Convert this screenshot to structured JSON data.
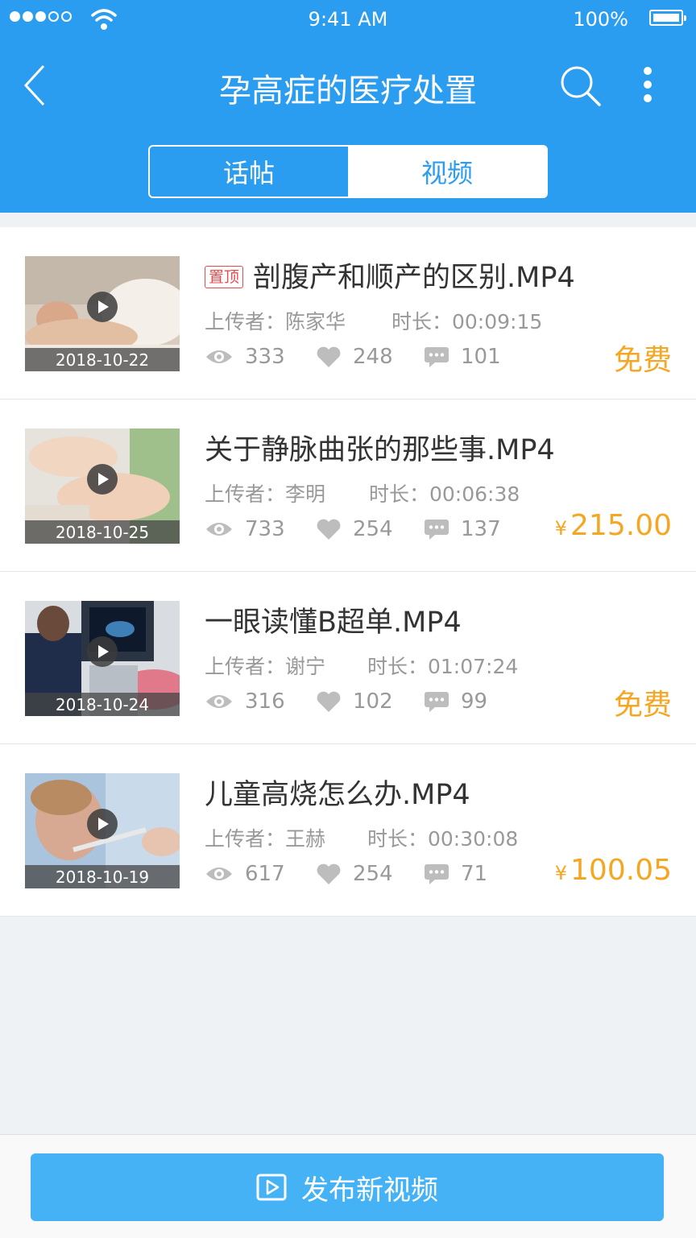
{
  "status_bar": {
    "time": "9:41 AM",
    "battery": "100%"
  },
  "nav": {
    "title": "孕高症的医疗处置"
  },
  "tabs": [
    {
      "label": "话帖",
      "active": false
    },
    {
      "label": "视频",
      "active": true
    }
  ],
  "videos": [
    {
      "pinned": true,
      "pin_label": "置顶",
      "title": "剖腹产和顺产的区别.MP4",
      "date": "2018-10-22",
      "uploader": "上传者：陈家华",
      "duration": "时长：00:09:15",
      "views": "333",
      "likes": "248",
      "comments": "101",
      "price": "免费",
      "currency": ""
    },
    {
      "pinned": false,
      "title": "关于静脉曲张的那些事.MP4",
      "date": "2018-10-25",
      "uploader": "上传者：李明",
      "duration": "时长：00:06:38",
      "views": "733",
      "likes": "254",
      "comments": "137",
      "price": "215.00",
      "currency": "¥"
    },
    {
      "pinned": false,
      "title": "一眼读懂B超单.MP4",
      "date": "2018-10-24",
      "uploader": "上传者：谢宁",
      "duration": "时长：01:07:24",
      "views": "316",
      "likes": "102",
      "comments": "99",
      "price": "免费",
      "currency": ""
    },
    {
      "pinned": false,
      "title": "儿童高烧怎么办.MP4",
      "date": "2018-10-19",
      "uploader": "上传者：王赫",
      "duration": "时长：00:30:08",
      "views": "617",
      "likes": "254",
      "comments": "71",
      "price": "100.05",
      "currency": "¥"
    }
  ],
  "footer": {
    "publish_label": "发布新视频"
  },
  "colors": {
    "primary": "#2b9df1",
    "button": "#45b2f5",
    "price": "#f5a623",
    "pin": "#e84b4b"
  }
}
